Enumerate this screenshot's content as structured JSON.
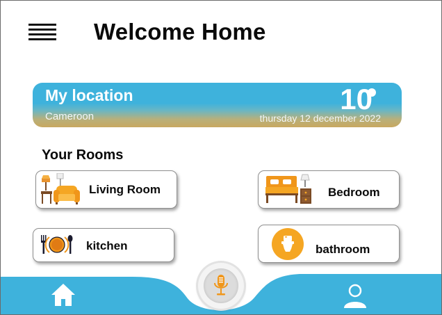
{
  "header": {
    "title": "Welcome Home",
    "menu_icon": "hamburger-menu-icon"
  },
  "location": {
    "title": "My location",
    "country": "Cameroon",
    "temperature": "10",
    "temperature_unit_icon": "degree-symbol",
    "date": "thursday 12 december 2022"
  },
  "rooms": {
    "title": "Your Rooms",
    "items": [
      {
        "label": "Living Room",
        "icon": "sofa-lamp-icon"
      },
      {
        "label": "Bedroom",
        "icon": "bed-nightstand-icon"
      },
      {
        "label": "kitchen",
        "icon": "plate-fork-spoon-icon"
      },
      {
        "label": "bathroom",
        "icon": "toilet-icon"
      }
    ]
  },
  "bottom_nav": {
    "home_icon": "home-icon",
    "mic_icon": "microphone-icon",
    "profile_icon": "user-profile-icon"
  },
  "colors": {
    "accent_blue": "#3eb2dc",
    "accent_orange": "#f5a623",
    "card_border": "#8f8f8f"
  }
}
